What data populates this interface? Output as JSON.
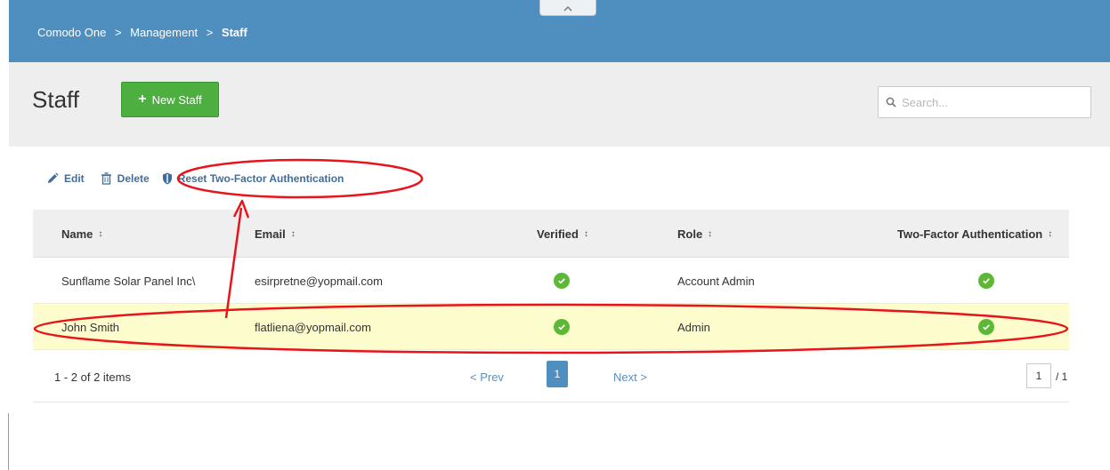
{
  "topbar": {
    "breadcrumb": {
      "item1": "Comodo One",
      "sep1": ">",
      "item2": "Management",
      "sep2": ">",
      "current": "Staff"
    },
    "collapse_icon": "chevron-up-icon"
  },
  "header": {
    "title": "Staff",
    "new_button_label": "New Staff",
    "new_button_icon": "plus-icon",
    "search_placeholder": "Search...",
    "search_icon": "search-icon"
  },
  "actions": {
    "edit_label": "Edit",
    "edit_icon": "pencil-icon",
    "delete_label": "Delete",
    "delete_icon": "trash-icon",
    "reset_2fa_label": "Reset Two-Factor Authentication",
    "reset_2fa_icon": "shield-icon"
  },
  "table": {
    "columns": [
      "Name",
      "Email",
      "Verified",
      "Role",
      "Two-Factor Authentication"
    ],
    "sort_icon": "↕",
    "rows": [
      {
        "name": "Sunflame Solar Panel Inc\\",
        "email": "esirpretne@yopmail.com",
        "verified": true,
        "role": "Account Admin",
        "two_factor": true,
        "selected": false
      },
      {
        "name": "John Smith",
        "email": "flatliena@yopmail.com",
        "verified": true,
        "role": "Admin",
        "two_factor": true,
        "selected": true
      }
    ]
  },
  "pager": {
    "count_text": "1 - 2 of 2 items",
    "prev_label": "< Prev",
    "current_page": "1",
    "next_label": "Next >",
    "page_input_value": "1",
    "page_total": "/ 1"
  },
  "colors": {
    "topbar": "#4f8fc0",
    "primary_button": "#4caf3f",
    "check": "#5cb835",
    "selected_row": "#fdfccc",
    "link": "#3f6e9a",
    "annotation": "#e8141b"
  }
}
